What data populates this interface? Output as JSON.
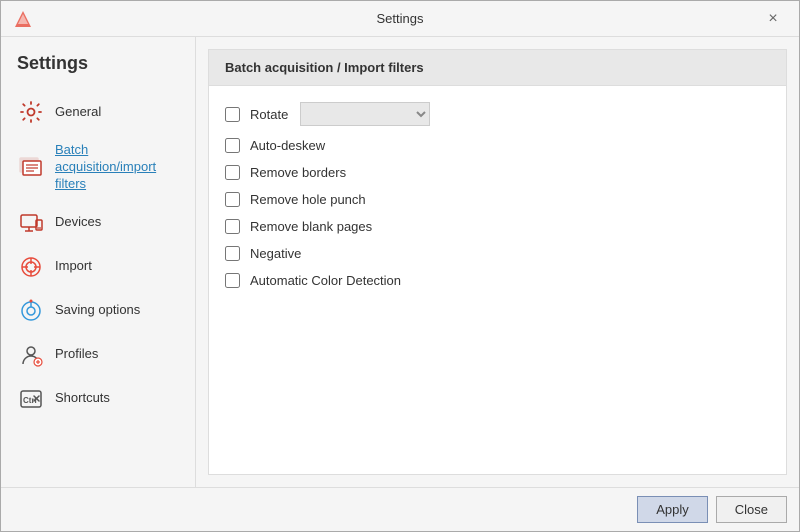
{
  "window": {
    "title": "Settings",
    "close_label": "×"
  },
  "sidebar": {
    "title": "Settings",
    "items": [
      {
        "id": "general",
        "label": "General",
        "icon": "gear"
      },
      {
        "id": "batch",
        "label": "Batch acquisition/import filters",
        "icon": "batch",
        "active": true
      },
      {
        "id": "devices",
        "label": "Devices",
        "icon": "devices"
      },
      {
        "id": "import",
        "label": "Import",
        "icon": "import"
      },
      {
        "id": "saving",
        "label": "Saving options",
        "icon": "saving"
      },
      {
        "id": "profiles",
        "label": "Profiles",
        "icon": "profiles"
      },
      {
        "id": "shortcuts",
        "label": "Shortcuts",
        "icon": "shortcuts"
      }
    ]
  },
  "panel": {
    "header": "Batch acquisition / Import filters",
    "options": [
      {
        "id": "rotate",
        "label": "Rotate",
        "checked": false,
        "has_dropdown": true
      },
      {
        "id": "auto_deskew",
        "label": "Auto-deskew",
        "checked": false
      },
      {
        "id": "remove_borders",
        "label": "Remove borders",
        "checked": false
      },
      {
        "id": "remove_hole_punch",
        "label": "Remove hole punch",
        "checked": false
      },
      {
        "id": "remove_blank_pages",
        "label": "Remove blank pages",
        "checked": false
      },
      {
        "id": "negative",
        "label": "Negative",
        "checked": false
      },
      {
        "id": "auto_color",
        "label": "Automatic Color Detection",
        "checked": false
      }
    ]
  },
  "footer": {
    "apply_label": "Apply",
    "close_label": "Close"
  }
}
